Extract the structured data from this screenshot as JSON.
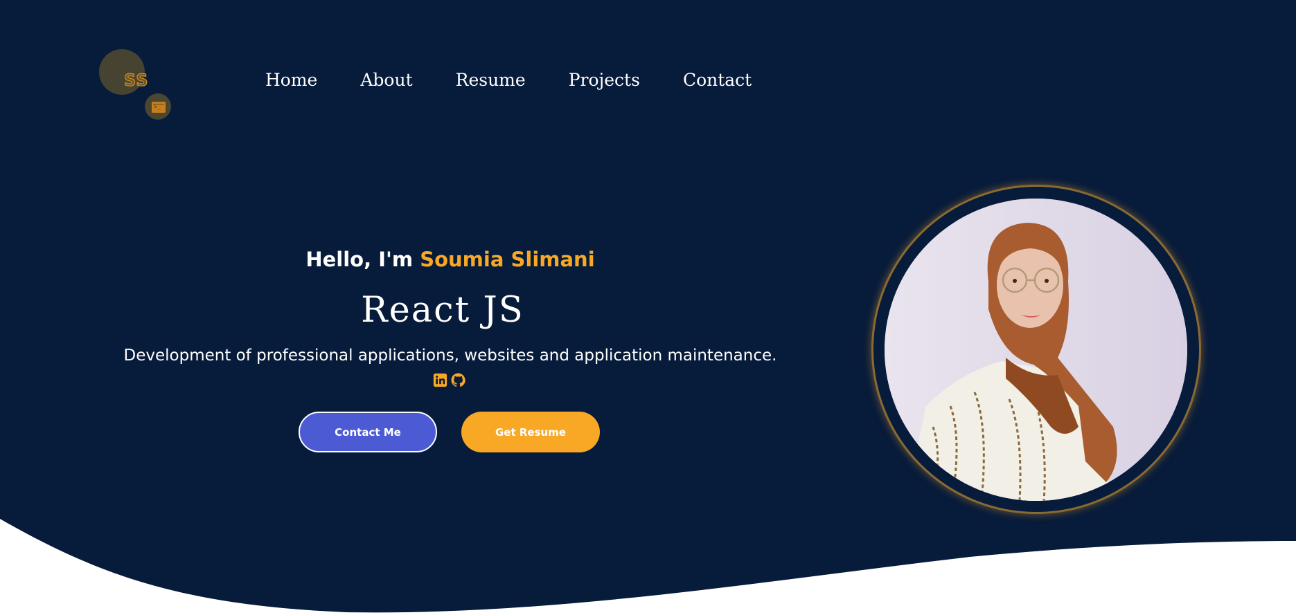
{
  "colors": {
    "background": "#071b3a",
    "accent": "#f9a826",
    "primary_button": "#4c5bd4",
    "text": "#ffffff",
    "wave": "#ffffff"
  },
  "logo": {
    "text": "SS",
    "icon": "terminal-icon"
  },
  "nav": {
    "items": [
      {
        "label": "Home"
      },
      {
        "label": "About"
      },
      {
        "label": "Resume"
      },
      {
        "label": "Projects"
      },
      {
        "label": "Contact"
      }
    ]
  },
  "hero": {
    "greeting": "Hello, I'm",
    "name": "Soumia Slimani",
    "role": "React JS",
    "description": "Development of professional applications, websites and application maintenance.",
    "socials": [
      {
        "icon": "linkedin-icon"
      },
      {
        "icon": "github-icon"
      }
    ],
    "buttons": {
      "contact": "Contact Me",
      "resume": "Get Resume"
    }
  },
  "profile_photo": {
    "icon": "profile-photo"
  }
}
